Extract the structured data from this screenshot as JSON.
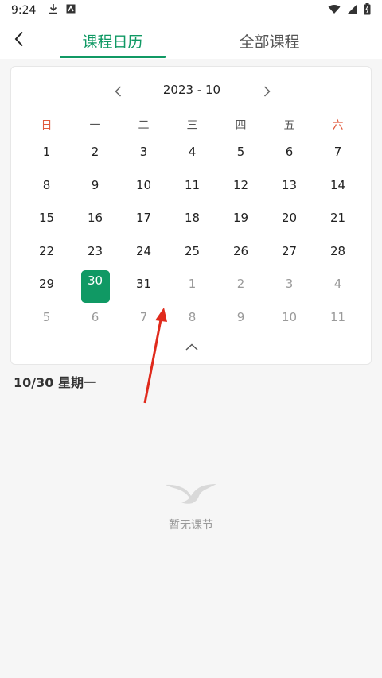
{
  "status_bar": {
    "time": "9:24",
    "icons": [
      "download-icon",
      "text-icon"
    ],
    "right_icons": [
      "wifi-icon",
      "signal-icon",
      "battery-icon"
    ]
  },
  "header": {
    "tabs": [
      {
        "label": "课程日历",
        "active": true
      },
      {
        "label": "全部课程",
        "active": false
      }
    ],
    "accent_color": "#109964"
  },
  "calendar": {
    "month_label": "2023 - 10",
    "weekdays": [
      "日",
      "一",
      "二",
      "三",
      "四",
      "五",
      "六"
    ],
    "days": [
      {
        "d": "1",
        "other": false
      },
      {
        "d": "2",
        "other": false
      },
      {
        "d": "3",
        "other": false
      },
      {
        "d": "4",
        "other": false
      },
      {
        "d": "5",
        "other": false
      },
      {
        "d": "6",
        "other": false
      },
      {
        "d": "7",
        "other": false
      },
      {
        "d": "8",
        "other": false
      },
      {
        "d": "9",
        "other": false
      },
      {
        "d": "10",
        "other": false
      },
      {
        "d": "11",
        "other": false
      },
      {
        "d": "12",
        "other": false
      },
      {
        "d": "13",
        "other": false
      },
      {
        "d": "14",
        "other": false
      },
      {
        "d": "15",
        "other": false
      },
      {
        "d": "16",
        "other": false
      },
      {
        "d": "17",
        "other": false
      },
      {
        "d": "18",
        "other": false
      },
      {
        "d": "19",
        "other": false
      },
      {
        "d": "20",
        "other": false
      },
      {
        "d": "21",
        "other": false
      },
      {
        "d": "22",
        "other": false
      },
      {
        "d": "23",
        "other": false
      },
      {
        "d": "24",
        "other": false
      },
      {
        "d": "25",
        "other": false
      },
      {
        "d": "26",
        "other": false
      },
      {
        "d": "27",
        "other": false
      },
      {
        "d": "28",
        "other": false
      },
      {
        "d": "29",
        "other": false
      },
      {
        "d": "30",
        "other": false,
        "selected": true
      },
      {
        "d": "31",
        "other": false
      },
      {
        "d": "1",
        "other": true
      },
      {
        "d": "2",
        "other": true
      },
      {
        "d": "3",
        "other": true
      },
      {
        "d": "4",
        "other": true
      },
      {
        "d": "5",
        "other": true
      },
      {
        "d": "6",
        "other": true
      },
      {
        "d": "7",
        "other": true
      },
      {
        "d": "8",
        "other": true
      },
      {
        "d": "9",
        "other": true
      },
      {
        "d": "10",
        "other": true
      },
      {
        "d": "11",
        "other": true
      }
    ]
  },
  "selected_date": {
    "label": "10/30  星期一"
  },
  "empty_state": {
    "text": "暂无课节"
  }
}
